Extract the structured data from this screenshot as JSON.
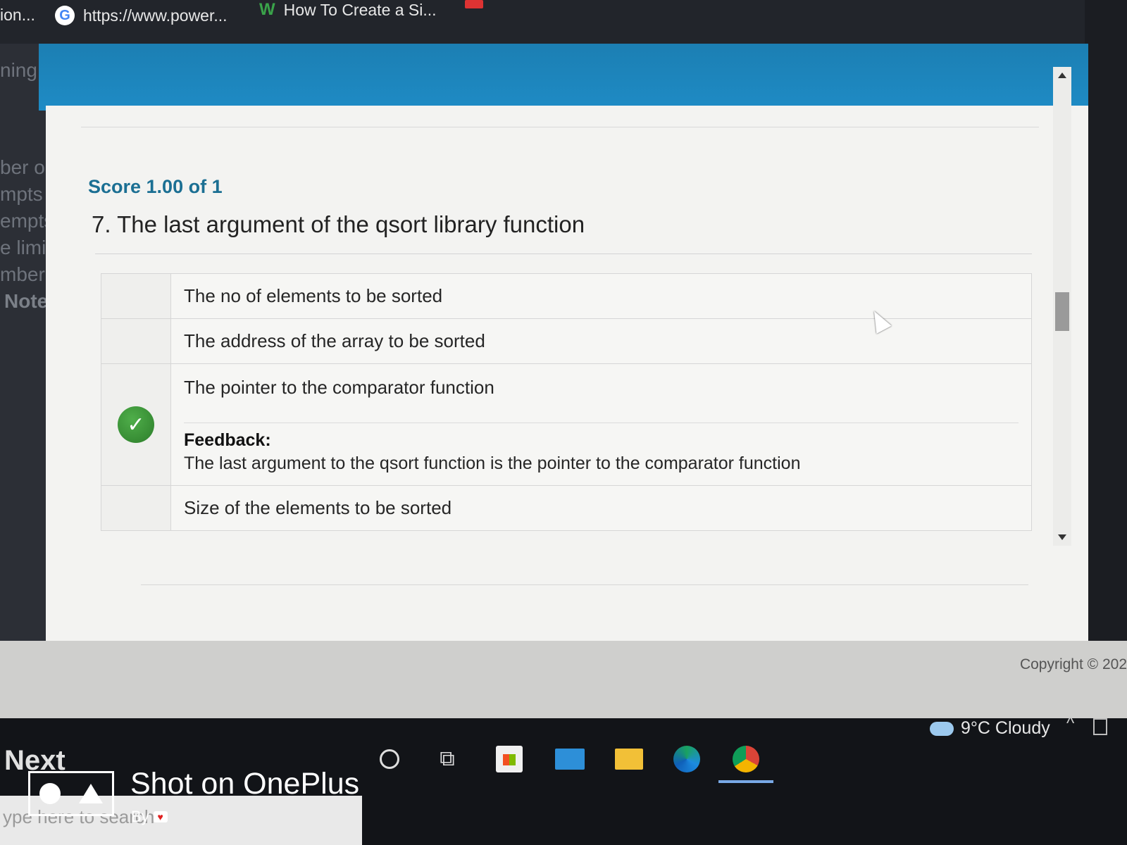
{
  "bookmarks": {
    "items": [
      {
        "label": "ion..."
      },
      {
        "icon": "google-icon",
        "label": "https://www.power..."
      },
      {
        "icon": "wikihow-icon",
        "label": "How To Create a Si..."
      },
      {
        "icon": "bookmark-red-icon",
        "label": ""
      }
    ]
  },
  "sidebar": {
    "fragments": [
      "ning",
      "ber o",
      "mpts",
      "empts",
      "e limit",
      "mber o",
      "Note :"
    ]
  },
  "quiz": {
    "score": "Score 1.00 of 1",
    "question": "7. The last argument of the qsort library function",
    "answers": [
      {
        "text": "The no of elements to be sorted",
        "correct": false
      },
      {
        "text": "The address of the array to be sorted",
        "correct": false
      },
      {
        "text": "The pointer to the comparator function",
        "correct": true,
        "feedback_title": "Feedback:",
        "feedback_text": "The last argument to the qsort function is the pointer to the comparator function"
      },
      {
        "text": "Size of the elements to be sorted",
        "correct": false
      }
    ]
  },
  "footer": {
    "copyright": "Copyright © 202"
  },
  "taskbar": {
    "search_placeholder": "ype here to search",
    "weather": "9°C  Cloudy",
    "apps": [
      "cortana-icon",
      "task-view-icon",
      "store-icon",
      "mail-icon",
      "file-explorer-icon",
      "edge-icon",
      "chrome-icon"
    ]
  },
  "watermark": {
    "title": "Shot on OnePlus",
    "by": "By",
    "logo_text": "Next"
  },
  "colors": {
    "header_blue": "#1e8bc5",
    "score_color": "#1b6f93",
    "correct_green": "#2c7d2a"
  }
}
